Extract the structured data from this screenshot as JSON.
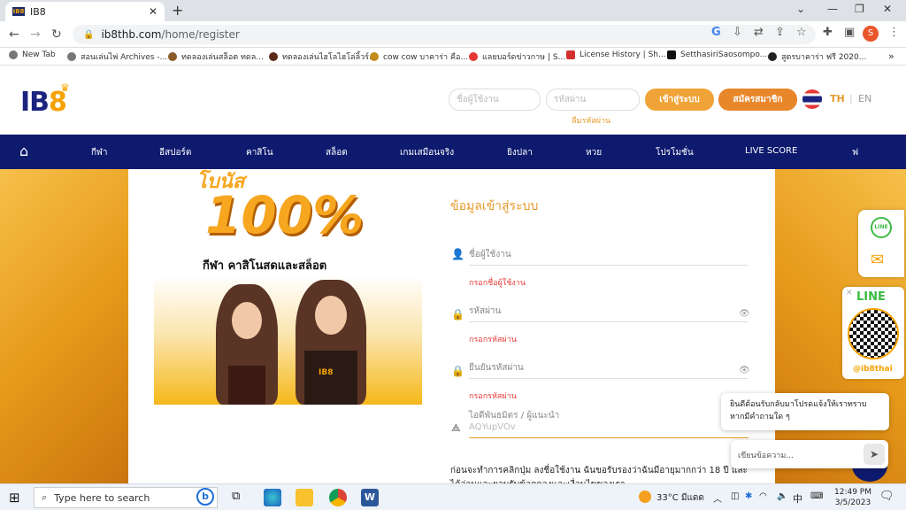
{
  "browser": {
    "tab_title": "IB8",
    "favicon_text": "IB8",
    "url_host": "ib8thb.com",
    "url_path": "/home/register",
    "profile_initial": "S",
    "bookmarks": [
      "New Tab",
      "สอนเล่นไพ่ Archives -...",
      "ทดลองเล่นสล็อต ทดล...",
      "ทดลองเล่นไฮโลไฮโล่ลิ้วร์...",
      "cow cow บาคาร่า คือ...",
      "แลยบอร์ดข่าวกาษ | S...",
      "License History | Sh...",
      "SetthasiriSaosompo...",
      "สูตรบาคาร่า ฟรี 2020..."
    ]
  },
  "header": {
    "logo": "IB",
    "logo_accent": "8",
    "username_placeholder": "ชื่อผู้ใช้งาน",
    "password_placeholder": "รหัสผ่าน",
    "forgot_password": "ลืมรหัสผ่าน",
    "login_button": "เข้าสู่ระบบ",
    "register_button": "สมัครสมาชิก",
    "lang_th": "TH",
    "lang_en": "EN"
  },
  "nav": [
    "กีฬา",
    "อีสปอร์ต",
    "คาสิโน",
    "สล็อต",
    "เกมเสมือนจริง",
    "ยิงปลา",
    "หวย",
    "โปรโมชั่น",
    "LIVE SCORE",
    "ฟ"
  ],
  "banner": {
    "big": "100%",
    "subtitle": "กีฬา คาสิโนสดและสล็อต",
    "shirt": "IB8"
  },
  "form": {
    "title": "ข้อมูลเข้าสู่ระบบ",
    "username_label": "ชื่อผู้ใช้งาน",
    "username_error": "กรอกชื่อผู้ใช้งาน",
    "password_label": "รหัสผ่าน",
    "password_error": "กรอกรหัสผ่าน",
    "confirm_label": "ยืนยันรหัสผ่าน",
    "confirm_error": "กรอกรหัสผ่าน",
    "referral_label": "ไอดีพันธมิตร / ผู้แนะนำ",
    "referral_value": "AQYupVOv",
    "terms": "ก่อนจะทำการคลิกปุ่ม ลงชื่อใช้งาน ฉันขอรับรองว่าฉันมีอายุมากกว่า 18 ปี และ ได้อ่านและยอมรับข้อตกลงและเงื่อนไขของเรา"
  },
  "side": {
    "line_title": "LINE",
    "line_id": "@ib8thai",
    "chat_message": "ยินดีต้อนรับกลับมาโปรดแจ้งให้เราทราบหากมีคำถามใด ๆ",
    "chat_placeholder": "เขียนข้อความ..."
  },
  "taskbar": {
    "search_placeholder": "Type here to search",
    "weather": "33°C มีแดด",
    "ime": "中",
    "time": "12:49 PM",
    "date": "3/5/2023"
  }
}
